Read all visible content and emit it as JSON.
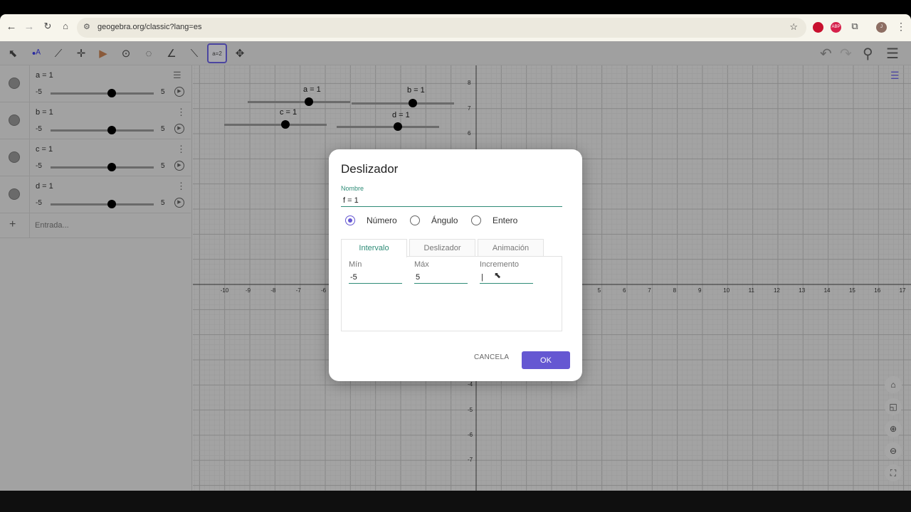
{
  "browser": {
    "url": "geogebra.org/classic?lang=es",
    "avatar_initial": "J"
  },
  "algebra": {
    "items": [
      {
        "name": "a = 1",
        "min": "-5",
        "max": "5"
      },
      {
        "name": "b = 1",
        "min": "-5",
        "max": "5"
      },
      {
        "name": "c = 1",
        "min": "-5",
        "max": "5"
      },
      {
        "name": "d = 1",
        "min": "-5",
        "max": "5"
      }
    ],
    "input_placeholder": "Entrada..."
  },
  "graph": {
    "sliders": [
      {
        "label": "a = 1"
      },
      {
        "label": "b = 1"
      },
      {
        "label": "c = 1"
      },
      {
        "label": "d = 1"
      }
    ],
    "x_ticks": [
      -10,
      -9,
      -8,
      -7,
      -6,
      5,
      6,
      7,
      8,
      9,
      10,
      11,
      12,
      13,
      14,
      15,
      16,
      17
    ],
    "y_ticks": [
      8,
      7,
      6,
      -4,
      -5,
      -6,
      -7
    ]
  },
  "dialog": {
    "title": "Deslizador",
    "name_label": "Nombre",
    "name_value": "f = 1",
    "radios": [
      "Número",
      "Ángulo",
      "Entero"
    ],
    "tabs": [
      "Intervalo",
      "Deslizador",
      "Animación"
    ],
    "min_label": "Mín",
    "min_value": "-5",
    "max_label": "Máx",
    "max_value": "5",
    "inc_label": "Incremento",
    "inc_value": "|",
    "cancel": "CANCELA",
    "ok": "OK"
  },
  "colors": {
    "accent": "#6557d2",
    "teal": "#2e8c77"
  }
}
